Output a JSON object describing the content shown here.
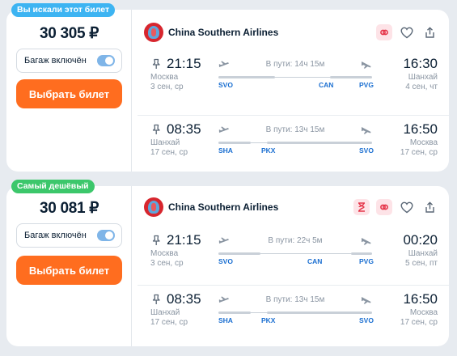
{
  "tickets": [
    {
      "badge": "Вы искали этот билет",
      "price": "30 305 ₽",
      "baggage": "Багаж включён",
      "select": "Выбрать билет",
      "airline": "China Southern Airlines",
      "segments": [
        {
          "dep_time": "21:15",
          "dep_city": "Москва",
          "dep_date": "3 сен, ср",
          "duration": "В пути: 14ч 15м",
          "arr_time": "16:30",
          "arr_city": "Шанхай",
          "arr_date": "4 сен, чт",
          "codes": [
            "SVO",
            "CAN",
            "PVG"
          ]
        },
        {
          "dep_time": "08:35",
          "dep_city": "Шанхай",
          "dep_date": "17 сен, ср",
          "duration": "В пути: 13ч 15м",
          "arr_time": "16:50",
          "arr_city": "Москва",
          "arr_date": "17 сен, ср",
          "codes": [
            "SHA",
            "PKX",
            "SVO"
          ]
        }
      ]
    },
    {
      "badge": "Самый дешёвый",
      "price": "30 081 ₽",
      "baggage": "Багаж включён",
      "select": "Выбрать билет",
      "airline": "China Southern Airlines",
      "segments": [
        {
          "dep_time": "21:15",
          "dep_city": "Москва",
          "dep_date": "3 сен, ср",
          "duration": "В пути: 22ч 5м",
          "arr_time": "00:20",
          "arr_city": "Шанхай",
          "arr_date": "5 сен, пт",
          "codes": [
            "SVO",
            "CAN",
            "PVG"
          ]
        },
        {
          "dep_time": "08:35",
          "dep_city": "Шанхай",
          "dep_date": "17 сен, ср",
          "duration": "В пути: 13ч 15м",
          "arr_time": "16:50",
          "arr_city": "Москва",
          "arr_date": "17 сен, ср",
          "codes": [
            "SHA",
            "PKX",
            "SVO"
          ]
        }
      ]
    }
  ],
  "colors": {
    "accent_orange": "#ff6d1f",
    "badge_blue": "#3db4f2",
    "badge_green": "#3cc76b",
    "airport_code": "#1b6fd1"
  },
  "icons": [
    "pin-icon",
    "plane-takeoff-icon",
    "plane-landing-icon",
    "heart-icon",
    "share-icon",
    "link-icon",
    "hourglass-icon"
  ]
}
